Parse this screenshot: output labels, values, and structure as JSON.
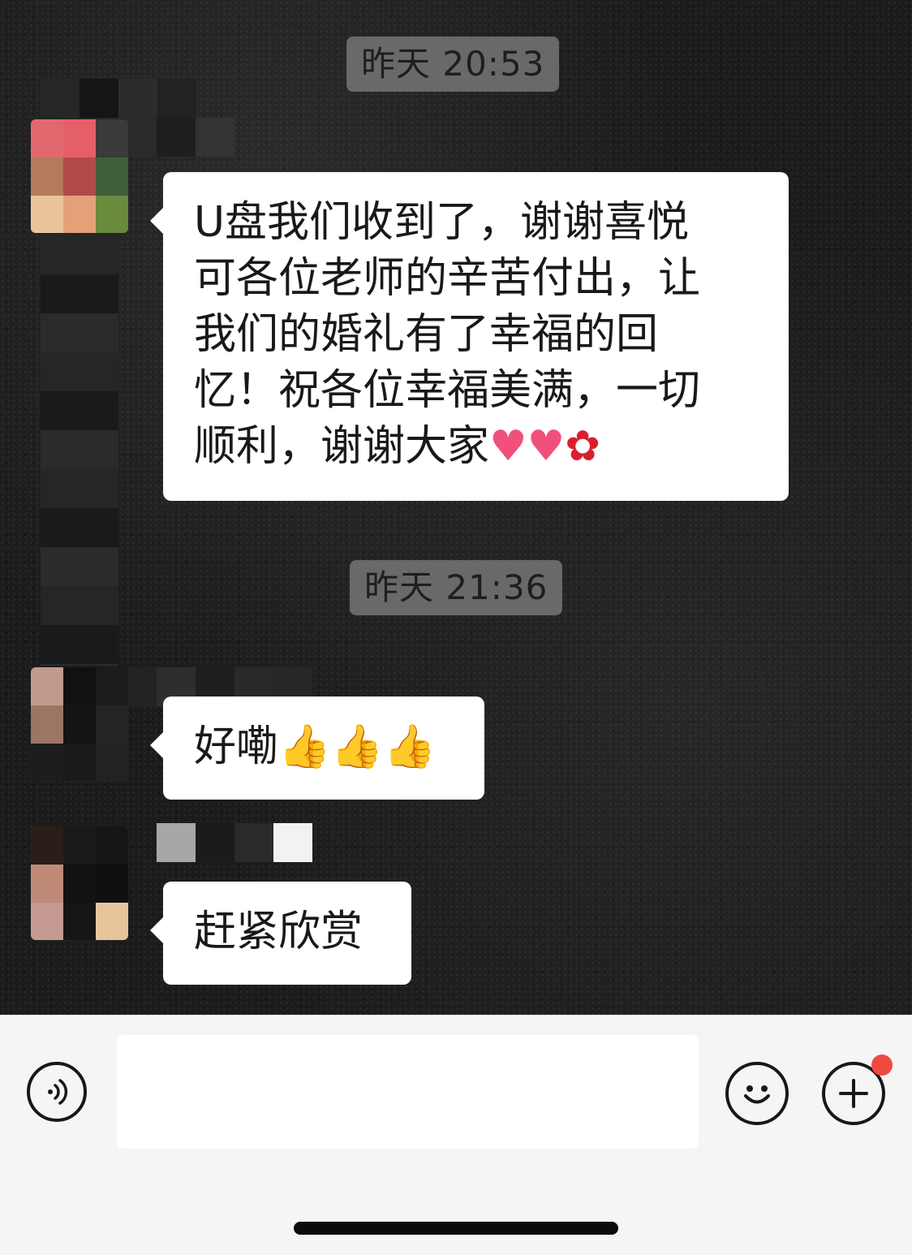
{
  "conversation": {
    "groups": [
      {
        "timestamp": "昨天 20:53",
        "messages": [
          {
            "lines": [
              "U盘我们收到了，谢谢喜悦",
              "可各位老师的辛苦付出，让",
              "我们的婚礼有了幸福的回",
              "忆！祝各位幸福美满，一切",
              "顺利，谢谢大家"
            ],
            "emojis": [
              "heart",
              "heart",
              "rose"
            ]
          }
        ]
      },
      {
        "timestamp": "昨天 21:36",
        "messages": [
          {
            "text": "好嘞",
            "emojis": [
              "thumbs-up",
              "thumbs-up",
              "thumbs-up"
            ]
          },
          {
            "text": "赶紧欣赏",
            "emojis": []
          }
        ]
      }
    ]
  },
  "input_bar": {
    "message_value": "",
    "voice_icon": "voice-icon",
    "emoji_icon": "emoji-icon",
    "plus_icon": "plus-icon",
    "badge_color": "#f04a40"
  },
  "glyphs": {
    "heart": "♥",
    "rose": "✿",
    "thumbs_up": "👍"
  }
}
